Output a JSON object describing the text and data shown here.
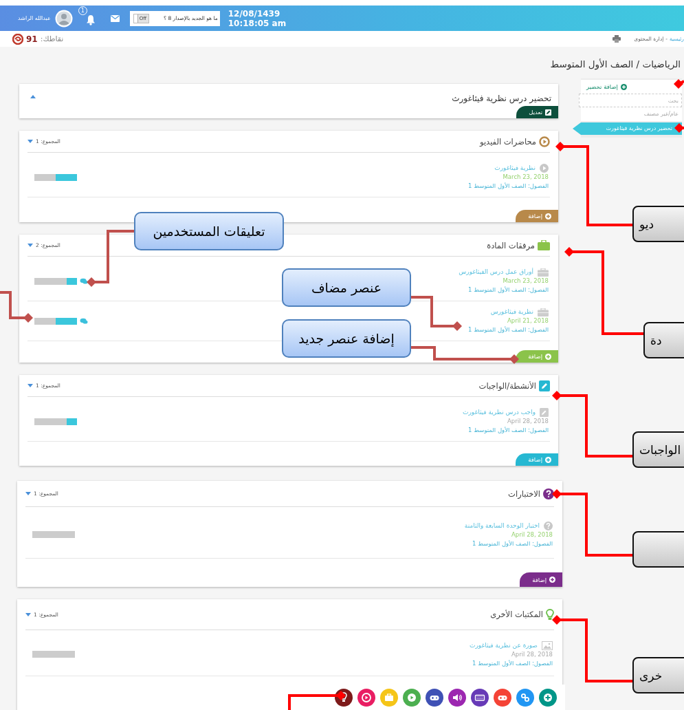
{
  "top_bar": {
    "user_name": "عبدالله الراشد",
    "notification_count": "1",
    "whats_new": "ما هو الجديد بالإصدار 8 ؟",
    "toggle": {
      "label": "Off",
      "on": false
    },
    "date": "12/08/1439",
    "time": "10:18:05 am"
  },
  "sub_bar": {
    "points_label": "نقاطك:",
    "points": "91",
    "breadcrumb": [
      {
        "label": "رئيسية",
        "link": true
      },
      {
        "label": "إدارة المحتوى",
        "link": false
      }
    ],
    "separator": "-"
  },
  "page_title": "الرياضيات / الصف الأول المتوسط",
  "lesson": {
    "title": "تحضير درس نظرية فيثاغورث",
    "edit_label": "تعديل"
  },
  "sections": [
    {
      "kind": "video",
      "title": "محاضرات الفيديو",
      "total": "المجموع: 1",
      "color": "#b8894a",
      "add_label": "إضافة",
      "items": [
        {
          "title": "نظرية فيثاغورث",
          "date": "March 23, 2018",
          "color": "#95d16e",
          "classes": "الفصول: الصف الأول المتوسط 1",
          "level": 0.5,
          "comments": false
        }
      ]
    },
    {
      "kind": "attachment",
      "title": "مرفقات المادة",
      "total": "المجموع: 2",
      "color": "#8bc34a",
      "add_label": "إضافة",
      "items": [
        {
          "title": "أوراق عمل درس الفيثاغورس",
          "date": "March 23, 2018",
          "color": "#95d16e",
          "classes": "الفصول: الصف الأول المتوسط 1",
          "level": 0.25,
          "comments": true
        },
        {
          "title": "نظرية فيثاغورس",
          "date": "April 21, 2018",
          "color": "#95d16e",
          "classes": "الفصول: الصف الأول المتوسط 1",
          "level": 0.5,
          "comments": true
        }
      ]
    },
    {
      "kind": "activity",
      "title": "الأنشطة/الواجبات",
      "total": "المجموع: 1",
      "color": "#26b8d2",
      "add_label": "إضافة",
      "items": [
        {
          "title": "واجب درس نظرية فيثاغورث",
          "date": "April 28, 2018",
          "color": "#a9a9a9",
          "classes": "الفصول: الصف الأول المتوسط 1",
          "level": 0.25,
          "comments": false
        }
      ]
    },
    {
      "kind": "quiz",
      "title": "الاختبارات",
      "total": "المجموع: 1",
      "color": "#7b2d8b",
      "add_label": "إضافة",
      "items": [
        {
          "title": "اختبار الوحدة السابعة والثامنة",
          "date": "April 28, 2018",
          "color": "#95d16e",
          "classes": "الفصول: الصف الأول المتوسط 1",
          "comments": false
        }
      ]
    },
    {
      "kind": "other",
      "title": "المكتبات الأخرى",
      "total": "المجموع: 1",
      "color": "#6cbf4a",
      "items": [
        {
          "title": "صورة عن نظرية فيثاغورث",
          "date": "April 28, 2018",
          "color": "#a9a9a9",
          "classes": "الفصول: الصف الأول المتوسط 1",
          "comments": false
        }
      ]
    }
  ],
  "sidebar": {
    "add_label": "إضافة تحضير",
    "search": {
      "placeholder": "بحث"
    },
    "category": "عام/غير مصنف",
    "items": [
      {
        "label": "تحضير درس نظرية فيثاغورث",
        "selected": true
      }
    ]
  },
  "tool_icons": [
    {
      "kind": "bulb",
      "color": "#7d1a1a"
    },
    {
      "kind": "play-ring",
      "color": "#e91e63"
    },
    {
      "kind": "briefcase",
      "color": "#f5c518"
    },
    {
      "kind": "play",
      "color": "#4caf50"
    },
    {
      "kind": "gamepad",
      "color": "#3f51b5"
    },
    {
      "kind": "speaker",
      "color": "#9c27b0"
    },
    {
      "kind": "keyboard",
      "color": "#673ab7"
    },
    {
      "kind": "gamepad",
      "color": "#f44336"
    },
    {
      "kind": "link",
      "color": "#2196f3"
    },
    {
      "kind": "plus",
      "color": "#009688"
    }
  ],
  "annotations": {
    "callouts": [
      {
        "text": "تعليقات المستخدمين"
      },
      {
        "text": "عنصر مضاف"
      },
      {
        "text": "إضافة عنصر جديد"
      }
    ],
    "labels": [
      {
        "text": "ديو"
      },
      {
        "text": "دة"
      },
      {
        "text": "الواجبات"
      },
      {
        "text": "خرى"
      }
    ]
  }
}
